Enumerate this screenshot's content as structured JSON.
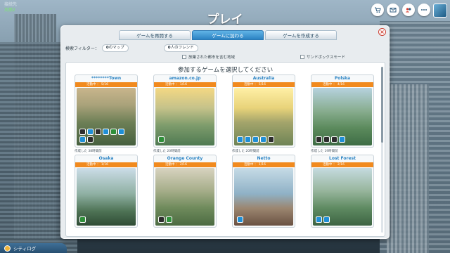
{
  "status": {
    "line1": "接続先",
    "line2": "実績2"
  },
  "screen_title": "プレイ",
  "top_icons": [
    "cart-icon",
    "mail-icon",
    "friends-icon",
    "more-icon"
  ],
  "tabs": [
    {
      "label": "ゲームを再開する",
      "active": false
    },
    {
      "label": "ゲームに加わる",
      "active": true
    },
    {
      "label": "ゲームを作成する",
      "active": false
    }
  ],
  "close_symbol": "×",
  "filter": {
    "label": "検索フィルター：",
    "maps_count": "0",
    "maps_label": "のマップ",
    "friends_count": "0",
    "friends_label": "人のフレンド",
    "check_abandoned": "放棄された都市を含む地域",
    "check_sandbox": "サンドボックスモード"
  },
  "list_heading": "参加するゲームを選択してください",
  "games": [
    {
      "name": "********Town",
      "status": "活動中 ： 5/16",
      "caption": "作成した 38時間前",
      "pins": 8
    },
    {
      "name": "amazon.co.jp",
      "status": "活動中 ： 1/16",
      "caption": "作成した 20時間前",
      "pins": 1
    },
    {
      "name": "Australia",
      "status": "活動中 ： 5/16",
      "caption": "作成した 20時間前",
      "pins": 5
    },
    {
      "name": "Polska",
      "status": "活動中 ： 4/16",
      "caption": "作成した 19時間前",
      "pins": 4
    },
    {
      "name": "Osaka",
      "status": "活動中 ： 1/16",
      "caption": "",
      "pins": 1
    },
    {
      "name": "Orange County",
      "status": "活動中 ： 2/16",
      "caption": "",
      "pins": 2
    },
    {
      "name": "Netto",
      "status": "活動中 ： 1/16",
      "caption": "",
      "pins": 1
    },
    {
      "name": "Lost Forest",
      "status": "活動中 ： 2/16",
      "caption": "",
      "pins": 2
    }
  ],
  "city_log": "シティログ"
}
